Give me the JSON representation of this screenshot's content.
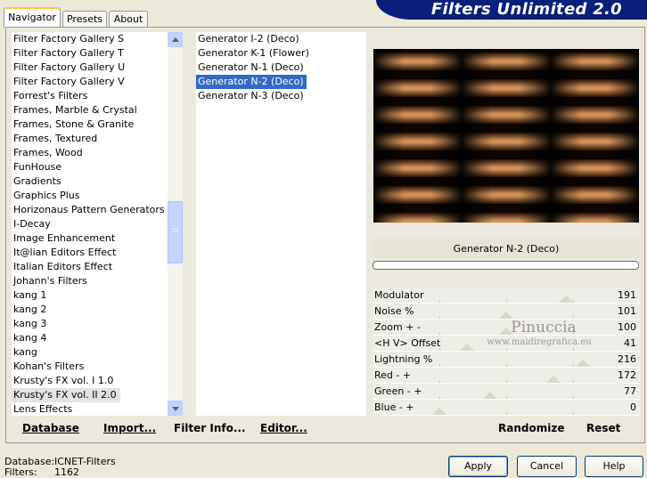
{
  "tabs": [
    {
      "label": "Navigator",
      "active": true
    },
    {
      "label": "Presets",
      "active": false
    },
    {
      "label": "About",
      "active": false
    }
  ],
  "brand": "Filters Unlimited 2.0",
  "categories": [
    "Filter Factory Gallery S",
    "Filter Factory Gallery T",
    "Filter Factory Gallery U",
    "Filter Factory Gallery V",
    "Forrest's Filters",
    "Frames, Marble & Crystal",
    "Frames, Stone & Granite",
    "Frames, Textured",
    "Frames, Wood",
    "FunHouse",
    "Gradients",
    "Graphics Plus",
    "Horizonaus Pattern Generators",
    "I-Decay",
    "Image Enhancement",
    "It@lian Editors Effect",
    "Italian Editors Effect",
    "Johann's Filters",
    "kang 1",
    "kang 2",
    "kang 3",
    "kang 4",
    "kang",
    "Kohan's Filters",
    "Krusty's FX vol. I 1.0",
    "Krusty's FX vol. II 2.0",
    "Lens Effects"
  ],
  "selected_category": "Krusty's FX vol. II 2.0",
  "filters": [
    "Generator I-2 (Deco)",
    "Generator K-1 (Flower)",
    "Generator N-1 (Deco)",
    "Generator N-2 (Deco)",
    "Generator N-3 (Deco)"
  ],
  "selected_filter": "Generator N-2 (Deco)",
  "bottom_buttons": {
    "database": "Database",
    "import": "Import...",
    "filter_info": "Filter Info...",
    "editor": "Editor...",
    "randomize": "Randomize",
    "reset": "Reset"
  },
  "preview_name": "Generator N-2 (Deco)",
  "params": [
    {
      "label": "Modulator",
      "value": 191
    },
    {
      "label": "Noise %",
      "value": 101
    },
    {
      "label": "Zoom + -",
      "value": 100
    },
    {
      "label": "<H V> Offset",
      "value": 41
    },
    {
      "label": "Lightning %",
      "value": 216
    },
    {
      "label": "Red - +",
      "value": 172
    },
    {
      "label": "Green - +",
      "value": 77
    },
    {
      "label": "Blue - +",
      "value": 0
    }
  ],
  "param_max": 255,
  "watermark": {
    "name": "Pinuccia",
    "url": "www.maidiregrafica.eu"
  },
  "status": {
    "database_label": "Database:",
    "database_value": "ICNET-Filters",
    "filters_label": "Filters:",
    "filters_value": "1162"
  },
  "dialog_buttons": {
    "apply": "Apply",
    "cancel": "Cancel",
    "help": "Help"
  },
  "colors": {
    "accent": "#316ac5",
    "brand_bg": "#0a1f7a",
    "preview_orange": "#d98a45"
  }
}
